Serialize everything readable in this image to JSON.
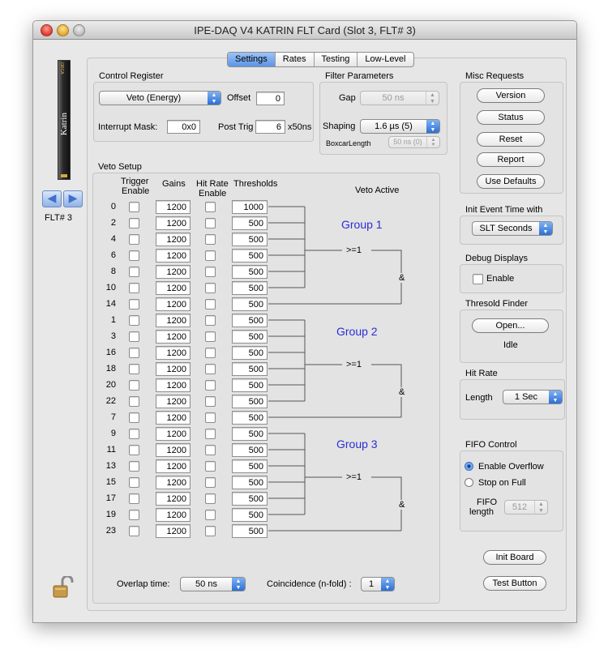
{
  "window": {
    "title": "IPE-DAQ V4 KATRIN FLT Card (Slot 3, FLT# 3)"
  },
  "sidebar": {
    "flt_label": "FLT# 3",
    "card_text": "Katrin",
    "card_small": "ORCA"
  },
  "tabs": [
    {
      "label": "Settings"
    },
    {
      "label": "Rates"
    },
    {
      "label": "Testing"
    },
    {
      "label": "Low-Level"
    }
  ],
  "control_register": {
    "title": "Control Register",
    "mode": "Veto (Energy)",
    "offset_label": "Offset",
    "offset_value": "0",
    "interrupt_label": "Interrupt Mask:",
    "interrupt_value": "0x0",
    "posttrig_label": "Post Trig",
    "posttrig_value": "6",
    "posttrig_unit": "x50ns"
  },
  "filter": {
    "title": "Filter Parameters",
    "gap_label": "Gap",
    "gap_value": "50 ns",
    "shaping_label": "Shaping",
    "shaping_value": "1.6 µs (5)",
    "boxcar_label": "BoxcarLength",
    "boxcar_value": "50 ns (0)"
  },
  "veto": {
    "title": "Veto Setup",
    "headers": {
      "trigger": "Trigger",
      "enable": "Enable",
      "gains": "Gains",
      "hitrate": "Hit Rate",
      "hitrate_enable": "Enable",
      "thresholds": "Thresholds",
      "veto_active": "Veto Active"
    },
    "rows": [
      {
        "ch": "0",
        "gain": "1200",
        "thr": "1000"
      },
      {
        "ch": "2",
        "gain": "1200",
        "thr": "500"
      },
      {
        "ch": "4",
        "gain": "1200",
        "thr": "500"
      },
      {
        "ch": "6",
        "gain": "1200",
        "thr": "500"
      },
      {
        "ch": "8",
        "gain": "1200",
        "thr": "500"
      },
      {
        "ch": "10",
        "gain": "1200",
        "thr": "500"
      },
      {
        "ch": "14",
        "gain": "1200",
        "thr": "500"
      },
      {
        "ch": "1",
        "gain": "1200",
        "thr": "500"
      },
      {
        "ch": "3",
        "gain": "1200",
        "thr": "500"
      },
      {
        "ch": "16",
        "gain": "1200",
        "thr": "500"
      },
      {
        "ch": "18",
        "gain": "1200",
        "thr": "500"
      },
      {
        "ch": "20",
        "gain": "1200",
        "thr": "500"
      },
      {
        "ch": "22",
        "gain": "1200",
        "thr": "500"
      },
      {
        "ch": "7",
        "gain": "1200",
        "thr": "500"
      },
      {
        "ch": "9",
        "gain": "1200",
        "thr": "500"
      },
      {
        "ch": "11",
        "gain": "1200",
        "thr": "500"
      },
      {
        "ch": "13",
        "gain": "1200",
        "thr": "500"
      },
      {
        "ch": "15",
        "gain": "1200",
        "thr": "500"
      },
      {
        "ch": "17",
        "gain": "1200",
        "thr": "500"
      },
      {
        "ch": "19",
        "gain": "1200",
        "thr": "500"
      },
      {
        "ch": "23",
        "gain": "1200",
        "thr": "500"
      }
    ],
    "groups": [
      {
        "label": "Group 1"
      },
      {
        "label": "Group 2"
      },
      {
        "label": "Group 3"
      }
    ],
    "or_label": ">=1",
    "and_label": "&",
    "overlap_label": "Overlap time:",
    "overlap_value": "50 ns",
    "coincidence_label": "Coincidence (n-fold) :",
    "coincidence_value": "1"
  },
  "misc": {
    "title": "Misc Requests",
    "buttons": {
      "version": "Version",
      "status": "Status",
      "reset": "Reset",
      "report": "Report",
      "defaults": "Use Defaults"
    }
  },
  "init_event": {
    "title": "Init Event Time with",
    "value": "SLT Seconds"
  },
  "debug": {
    "title": "Debug Displays",
    "enable_label": "Enable"
  },
  "threshold_finder": {
    "title": "Thresold Finder",
    "button": "Open...",
    "status": "Idle"
  },
  "hit_rate": {
    "title": "Hit Rate",
    "length_label": "Length",
    "length_value": "1 Sec"
  },
  "fifo": {
    "title": "FIFO Control",
    "enable_overflow": "Enable Overflow",
    "stop_on_full": "Stop on Full",
    "length_label_1": "FIFO",
    "length_label_2": "length",
    "length_value": "512"
  },
  "buttons": {
    "init_board": "Init Board",
    "test_button": "Test Button"
  }
}
